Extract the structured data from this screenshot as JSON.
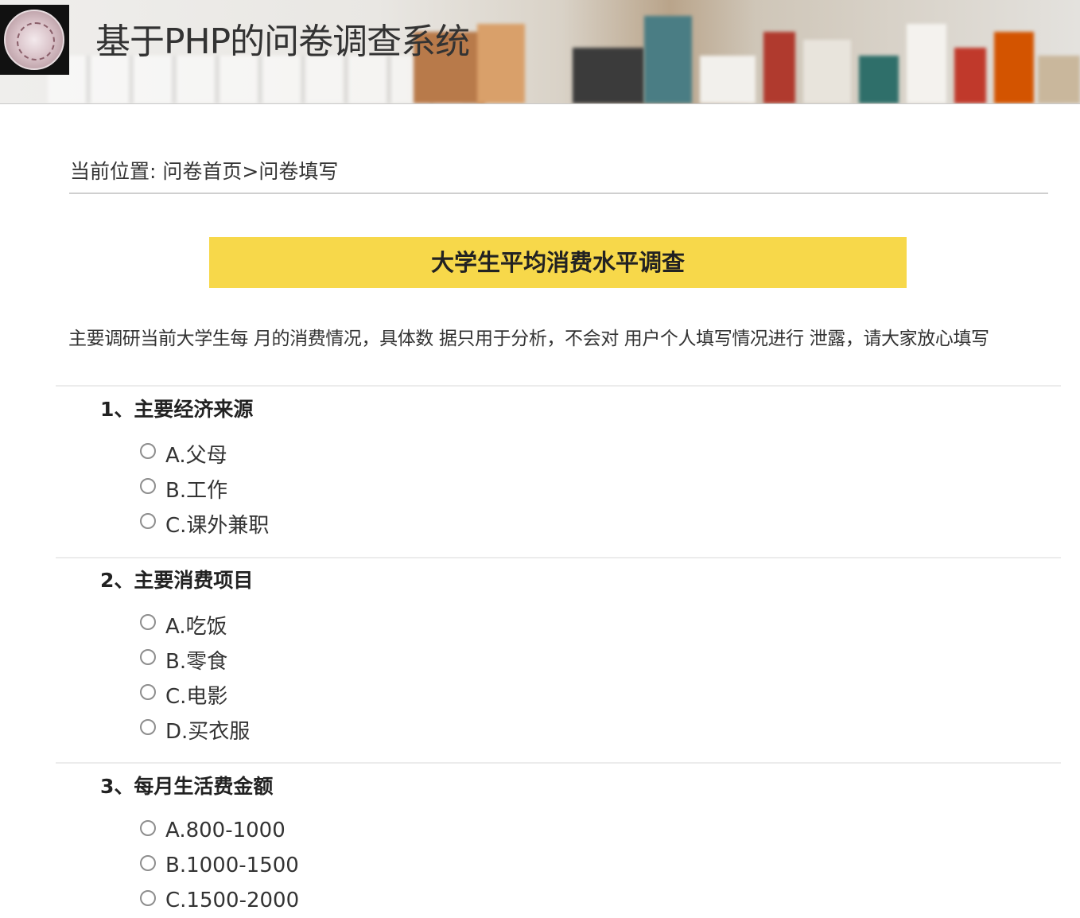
{
  "header": {
    "site_title": "基于PHP的问卷调查系统",
    "logo_icon": "university-seal-logo"
  },
  "breadcrumb": {
    "label": "当前位置:",
    "path": "问卷首页>问卷填写"
  },
  "survey": {
    "title": "大学生平均消费水平调查",
    "title_bg_color": "#f7d84a",
    "description": "主要调研当前大学生每 月的消费情况，具体数 据只用于分析，不会对 用户个人填写情况进行 泄露，请大家放心填写",
    "questions": [
      {
        "title": "1、主要经济来源",
        "options": [
          "A.父母",
          "B.工作",
          "C.课外兼职"
        ]
      },
      {
        "title": "2、主要消费项目",
        "options": [
          "A.吃饭",
          "B.零食",
          "C.电影",
          "D.买衣服"
        ]
      },
      {
        "title": "3、每月生活费金额",
        "options": [
          "A.800-1000",
          "B.1000-1500",
          "C.1500-2000"
        ]
      }
    ]
  }
}
